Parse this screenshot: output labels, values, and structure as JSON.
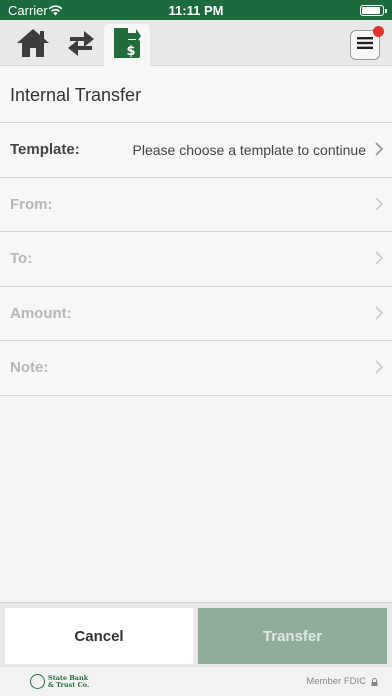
{
  "status_bar": {
    "carrier": "Carrier",
    "time": "11:11 PM",
    "battery_level": 0.9
  },
  "toolbar": {
    "home_icon": "home-icon",
    "transfer_icon": "arrows-swap-icon",
    "active_icon": "money-transfer-icon",
    "menu_icon": "hamburger-menu-icon",
    "notification_color": "#e1322d",
    "accent_color": "#1c6b3f"
  },
  "page": {
    "title": "Internal Transfer"
  },
  "form": {
    "template": {
      "label": "Template:",
      "value": "Please choose a template to continue"
    },
    "from": {
      "label": "From:"
    },
    "to": {
      "label": "To:"
    },
    "amount": {
      "label": "Amount:"
    },
    "note": {
      "label": "Note:"
    }
  },
  "buttons": {
    "cancel": "Cancel",
    "transfer": "Transfer"
  },
  "footer": {
    "bank_line1": "State Bank",
    "bank_line2": "& Trust Co.",
    "fdic": "Member FDIC"
  }
}
